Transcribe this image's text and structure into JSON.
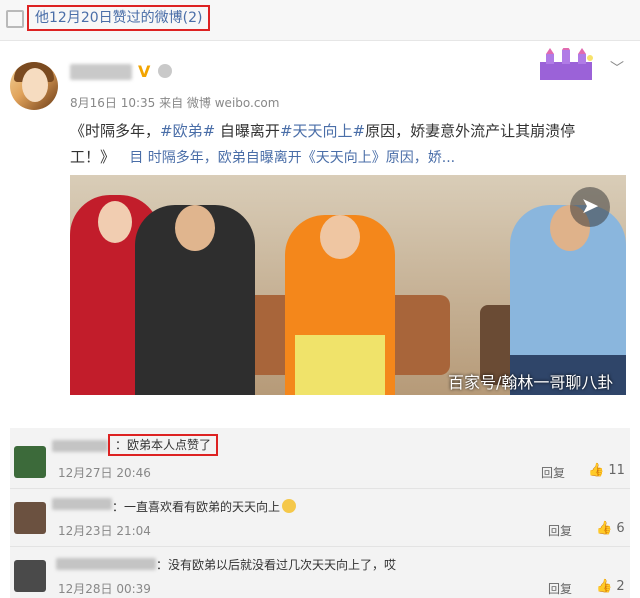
{
  "header": {
    "title": "他12月20日赞过的微博(2)"
  },
  "post": {
    "meta": "8月16日 10:35 来自 微博 weibo.com",
    "text_segments": [
      {
        "t": "《时隔多年，",
        "link": false
      },
      {
        "t": "#欧弟#",
        "link": true
      },
      {
        "t": " 自曝离开",
        "link": false
      },
      {
        "t": "#天天向上#",
        "link": true
      },
      {
        "t": "原因，娇妻意外流产让其崩溃停",
        "link": false
      }
    ],
    "line2_prefix": "工！》",
    "link_card": "目 时隔多年，欧弟自曝离开《天天向上》原因，娇...",
    "image_watermark": "百家号/翰林一哥聊八卦"
  },
  "comments": [
    {
      "text": "：欧弟本人点赞了",
      "time": "12月27日 20:46",
      "reply": "回复",
      "likes": "11"
    },
    {
      "text": "：一直喜欢看有欧弟的天天向上",
      "time": "12月23日 21:04",
      "reply": "回复",
      "likes": "6"
    },
    {
      "text": "：没有欧弟以后就没看过几次天天向上了，哎",
      "time": "12月28日 00:39",
      "reply": "回复",
      "likes": "2"
    }
  ],
  "colors": {
    "link": "#4a6ea8",
    "highlight_box": "#dd2222",
    "vip": "#f2a400"
  }
}
